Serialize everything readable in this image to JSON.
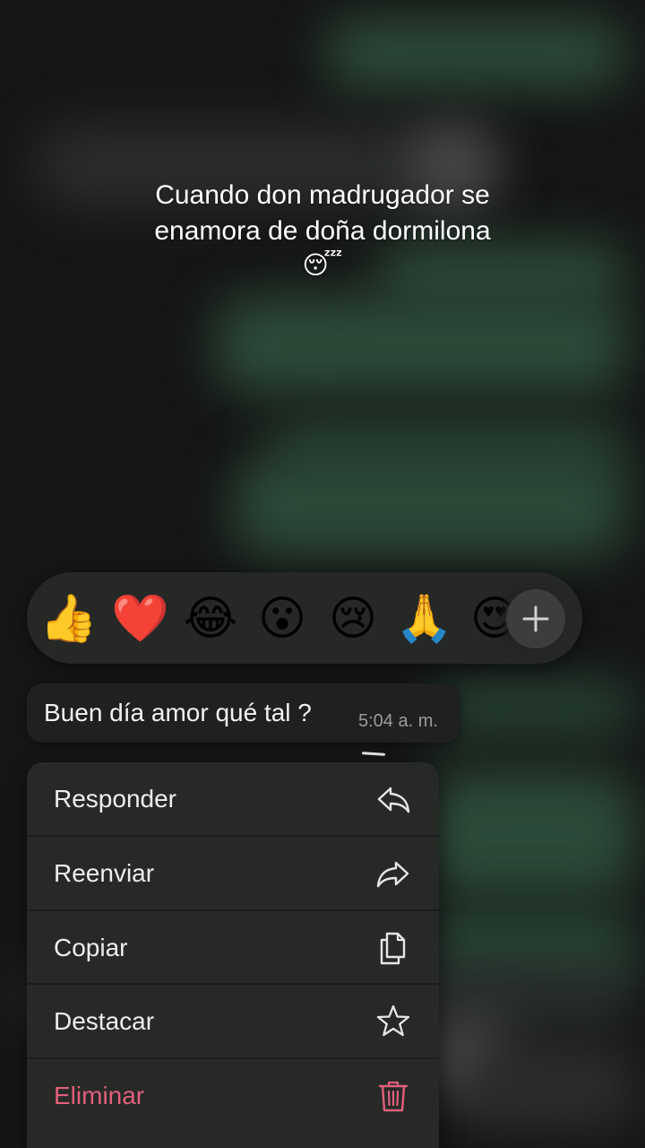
{
  "caption": {
    "line1": "Cuando don madrugador se",
    "line2": "enamora de doña dormilona",
    "emoji": "😴"
  },
  "reactions": {
    "items": [
      {
        "emoji": "👍",
        "icon": "thumbs-up-icon"
      },
      {
        "emoji": "❤️",
        "icon": "heart-icon"
      },
      {
        "emoji": "😂",
        "icon": "tears-of-joy-icon"
      },
      {
        "emoji": "😮",
        "icon": "surprised-face-icon"
      },
      {
        "emoji": "😢",
        "icon": "crying-face-icon"
      },
      {
        "emoji": "🙏",
        "icon": "folded-hands-icon"
      },
      {
        "emoji": "😍",
        "icon": "heart-eyes-icon"
      }
    ],
    "more_icon": "plus-icon"
  },
  "message": {
    "text": "Buen día amor qué tal ?",
    "time": "5:04 a. m."
  },
  "menu": {
    "items": [
      {
        "label": "Responder",
        "icon": "reply-icon"
      },
      {
        "label": "Reenviar",
        "icon": "forward-icon"
      },
      {
        "label": "Copiar",
        "icon": "copy-icon"
      },
      {
        "label": "Destacar",
        "icon": "star-icon"
      },
      {
        "label": "Eliminar",
        "icon": "trash-icon",
        "danger": true
      }
    ]
  },
  "colors": {
    "danger": "#e0607a",
    "menu_bg": "#272927",
    "bubble_bg": "#1f201f"
  }
}
